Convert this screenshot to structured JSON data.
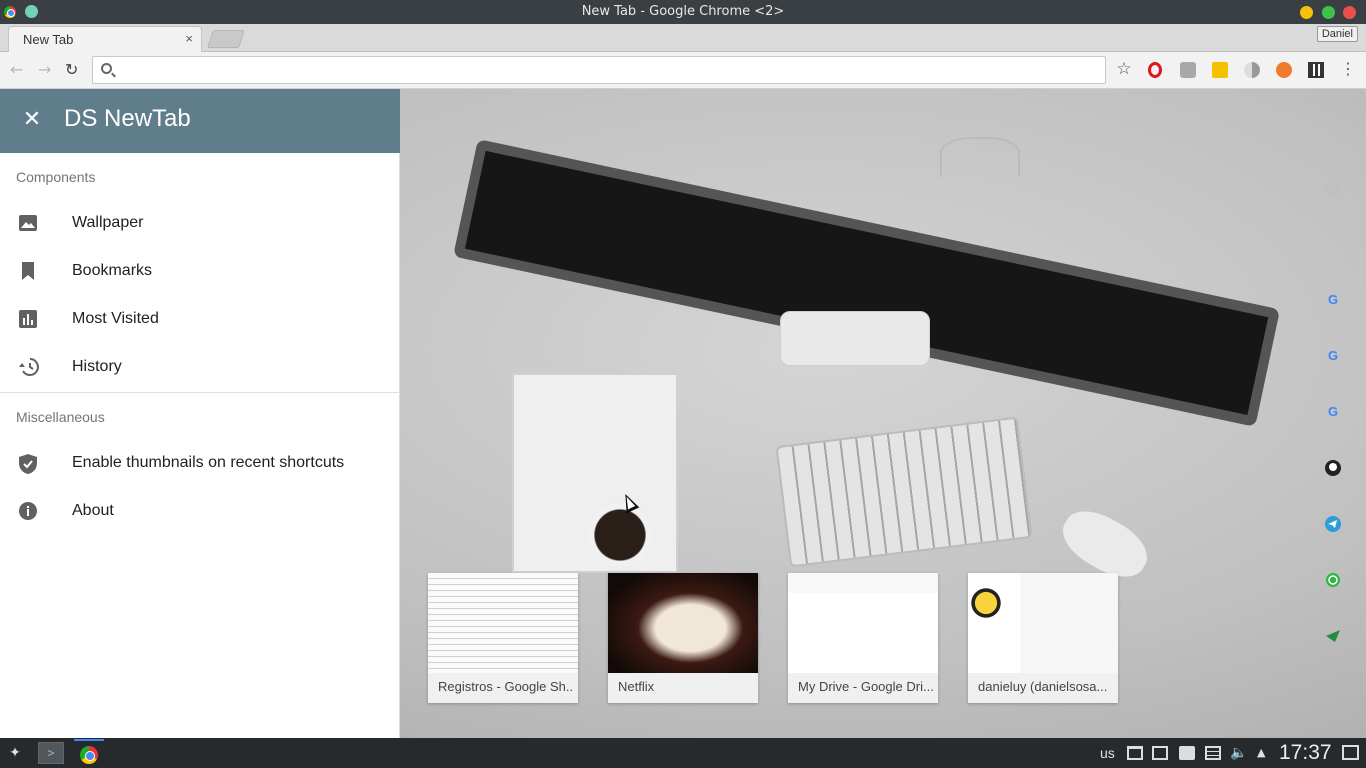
{
  "window": {
    "title": "New Tab - Google Chrome <2>",
    "profile": "Daniel"
  },
  "tabs": [
    {
      "label": "New Tab",
      "close": "×"
    }
  ],
  "toolbar": {
    "back": "←",
    "forward": "→",
    "reload": "↻",
    "omnibox_value": "",
    "omnibox_placeholder": "",
    "bookmark_star": "☆",
    "menu": "⋮",
    "extensions": [
      "opera-icon",
      "react-icon",
      "yellow-ext-icon",
      "moon-icon",
      "orange-ext-icon",
      "qr-code-icon"
    ]
  },
  "sidebar": {
    "close": "✕",
    "title": "DS NewTab",
    "header_color": "#607d8b",
    "sections": [
      {
        "label": "Components",
        "items": [
          {
            "label": "Wallpaper",
            "icon": "image-icon"
          },
          {
            "label": "Bookmarks",
            "icon": "bookmark-icon"
          },
          {
            "label": "Most Visited",
            "icon": "bar-chart-icon"
          },
          {
            "label": "History",
            "icon": "history-icon"
          }
        ]
      },
      {
        "label": "Miscellaneous",
        "items": [
          {
            "label": "Enable thumbnails on recent shortcuts",
            "icon": "shield-check-icon"
          },
          {
            "label": "About",
            "icon": "info-icon"
          }
        ]
      }
    ]
  },
  "rail": {
    "icons": [
      "square-icon",
      "star-icon",
      "google-icon",
      "google-icon",
      "google-icon",
      "github-icon",
      "telegram-icon",
      "whatsapp-icon",
      "send-icon"
    ],
    "google_glyph": "G"
  },
  "thumbnails": [
    {
      "caption": "Registros - Google Sh..."
    },
    {
      "caption": "Netflix"
    },
    {
      "caption": "My Drive - Google Dri..."
    },
    {
      "caption": "danieluy (danielsosa..."
    }
  ],
  "taskbar": {
    "keyboard_layout": "us",
    "clock": "17:37",
    "terminal_glyph": ">"
  }
}
